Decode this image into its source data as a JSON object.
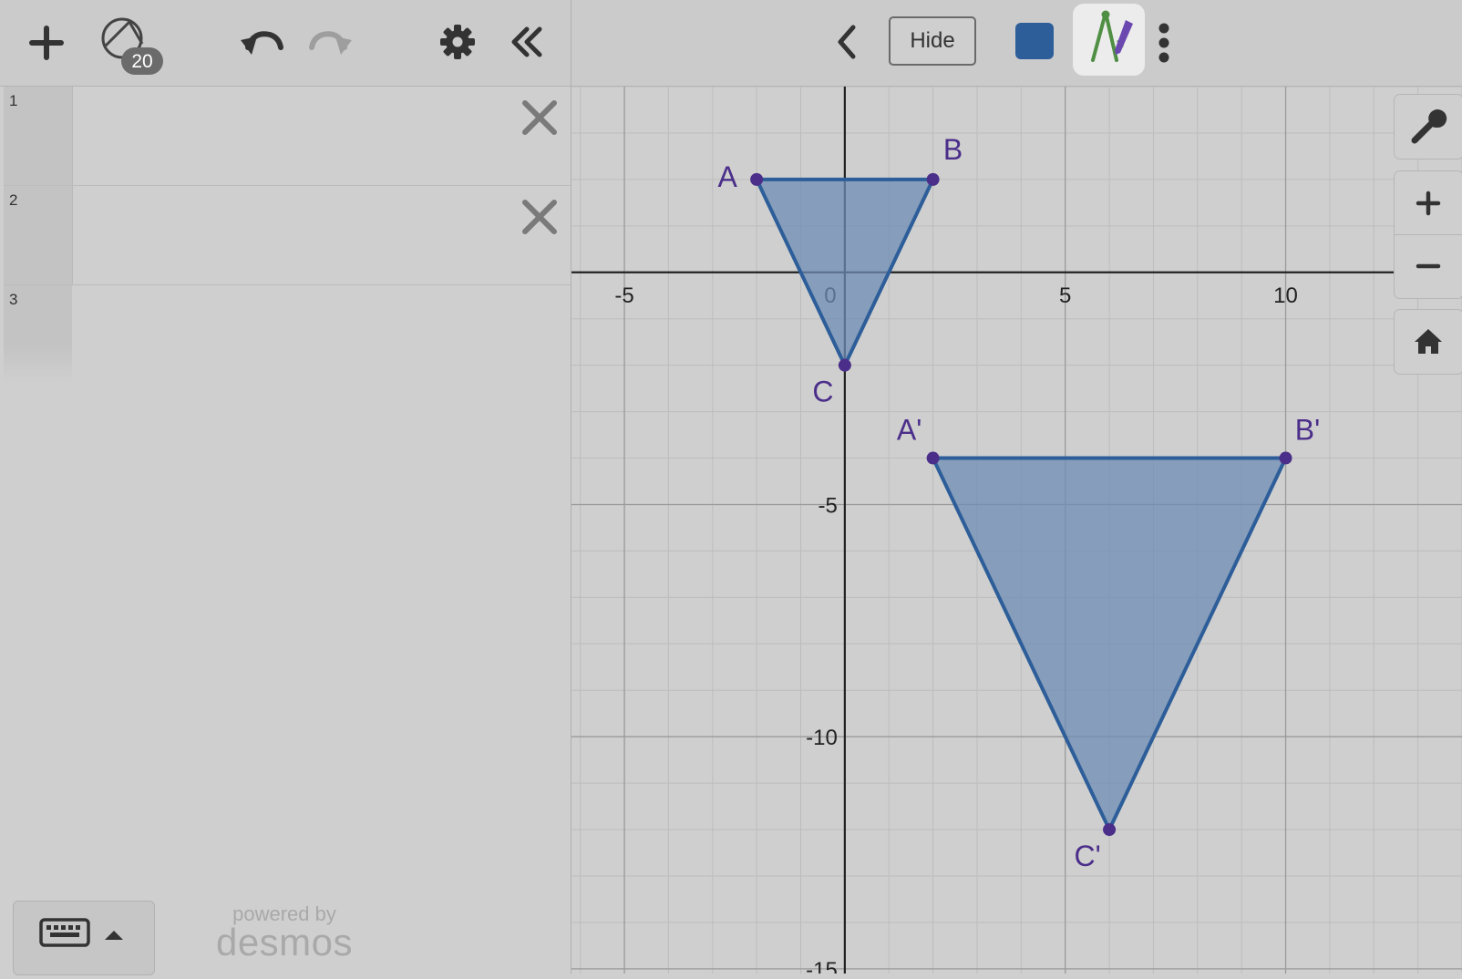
{
  "toolbar": {
    "shape_count_badge": "20",
    "hide_label": "Hide"
  },
  "expressions": [
    {
      "index": "1",
      "value": ""
    },
    {
      "index": "2",
      "value": ""
    },
    {
      "index": "3",
      "value": ""
    }
  ],
  "branding": {
    "powered_by": "powered by",
    "brand": "desmos"
  },
  "colors": {
    "accent": "#2d5e99",
    "point": "#4b2e8a",
    "label": "#4b2e8a",
    "fill": "#6e8cb4"
  },
  "icons": [
    "plus-icon",
    "geometry-icon",
    "undo-icon",
    "redo-icon",
    "gear-icon",
    "collapse-icon",
    "chevron-left-icon",
    "compass-icon",
    "more-icon",
    "wrench-icon",
    "zoom-in-icon",
    "zoom-out-icon",
    "home-icon",
    "keyboard-icon",
    "caret-up-icon",
    "close-icon"
  ],
  "chart_data": {
    "type": "scatter",
    "xlim": [
      -6.2,
      14
    ],
    "ylim": [
      -15.1,
      4
    ],
    "grid": true,
    "x_ticks": [
      "-5",
      "0",
      "5",
      "10"
    ],
    "y_ticks": [
      "-5",
      "-10",
      "-15"
    ],
    "series": [
      {
        "points": [
          {
            "label": "A",
            "x": -2,
            "y": 2
          },
          {
            "label": "B",
            "x": 2,
            "y": 2
          },
          {
            "label": "C",
            "x": 0,
            "y": -2
          }
        ]
      },
      {
        "points": [
          {
            "label": "A'",
            "x": 2,
            "y": -4
          },
          {
            "label": "B'",
            "x": 10,
            "y": -4
          },
          {
            "label": "C'",
            "x": 6,
            "y": -12
          }
        ]
      }
    ]
  }
}
